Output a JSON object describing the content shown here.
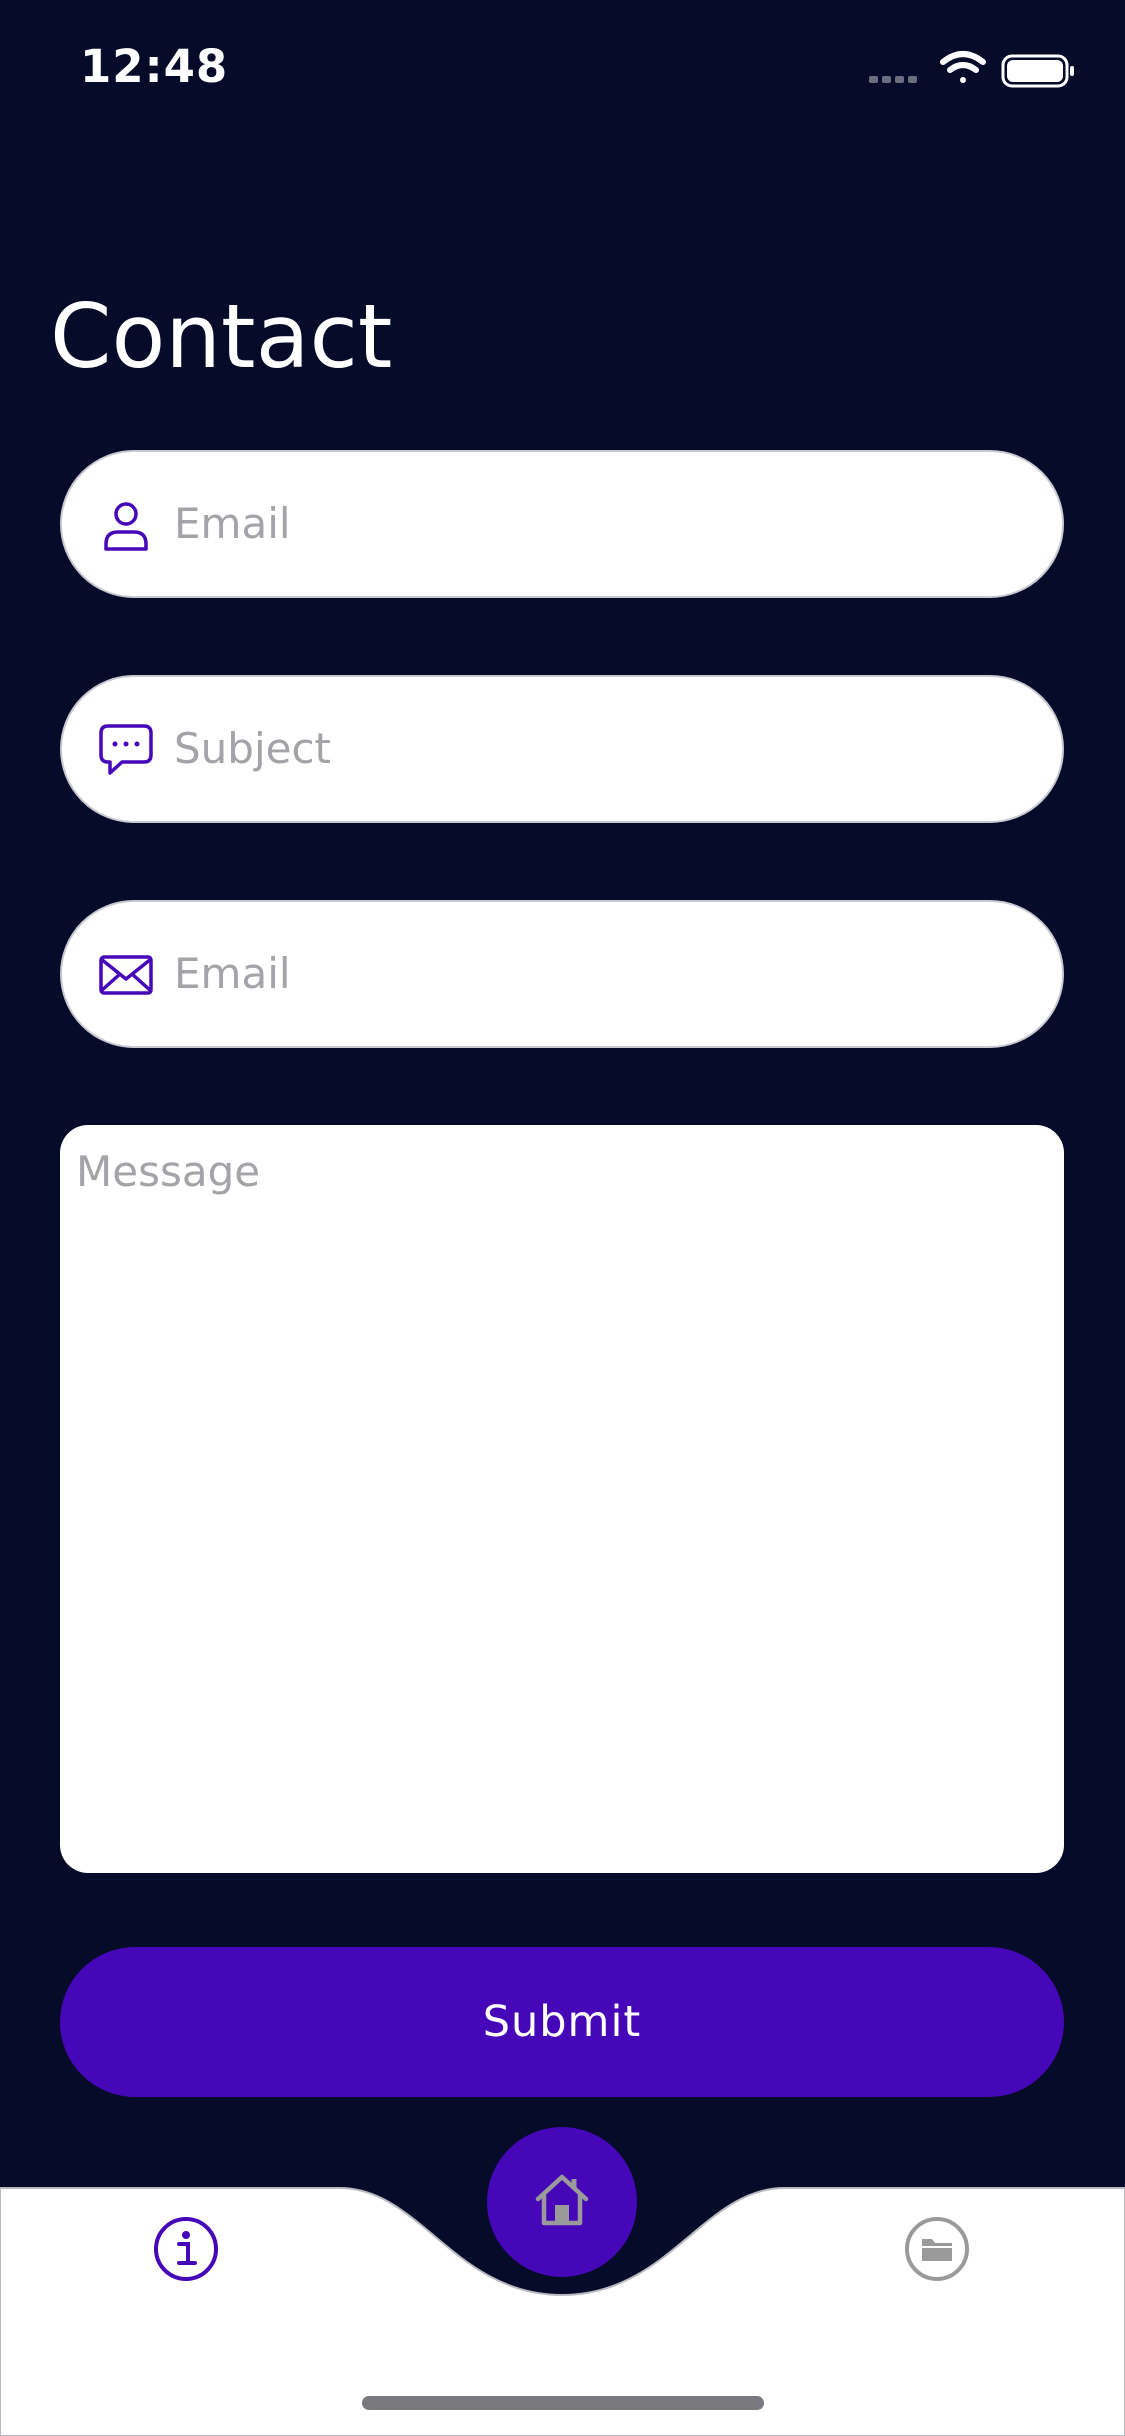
{
  "status_bar": {
    "time": "12:48",
    "icons": [
      "signal-icon",
      "wifi-icon",
      "battery-icon"
    ]
  },
  "page": {
    "title": "Contact"
  },
  "form": {
    "fields": [
      {
        "icon": "person-icon",
        "placeholder": "Email"
      },
      {
        "icon": "chat-bubble-icon",
        "placeholder": "Subject"
      },
      {
        "icon": "envelope-icon",
        "placeholder": "Email"
      }
    ],
    "message_placeholder": "Message",
    "submit_label": "Submit"
  },
  "tab_bar": {
    "items": [
      {
        "icon": "info-icon"
      },
      {
        "icon": "home-icon"
      },
      {
        "icon": "folder-icon"
      }
    ]
  },
  "colors": {
    "background": "#070b2a",
    "accent": "#4607b9",
    "placeholder": "#a3a3a8",
    "inactive_icon": "#9a9a9a"
  }
}
